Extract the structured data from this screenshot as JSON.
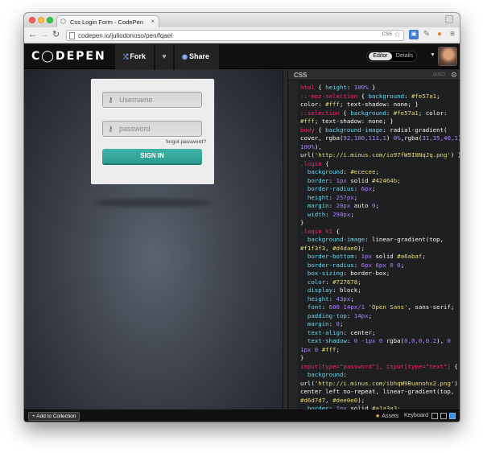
{
  "browser": {
    "tab_title": "Css Login Form - CodePen",
    "tab_close": "×",
    "url": "codepen.io/juliodonoso/pen/fqael",
    "url_badge": "CSS",
    "nav": {
      "back": "←",
      "forward": "→",
      "reload": "↻"
    }
  },
  "codepen": {
    "logo": "C◯DEPEN",
    "fork_label": "Fork",
    "share_label": "Share",
    "heart": "♥",
    "editor_tab": "Editor",
    "details_tab": "Details"
  },
  "login_form": {
    "username_placeholder": "Username",
    "password_placeholder": "password",
    "forgot_password": "forgot password?",
    "sign_in": "SIGN IN"
  },
  "editor": {
    "title": "CSS",
    "esc": "(ESC)"
  },
  "footer": {
    "add_to_collection": "+ Add to Collection",
    "assets": "Assets",
    "keyboard": "Keyboard"
  },
  "colors": {
    "accent_teal": "#2fa093",
    "codepen_bg": "#101010",
    "result_bg": "#3e434c"
  }
}
